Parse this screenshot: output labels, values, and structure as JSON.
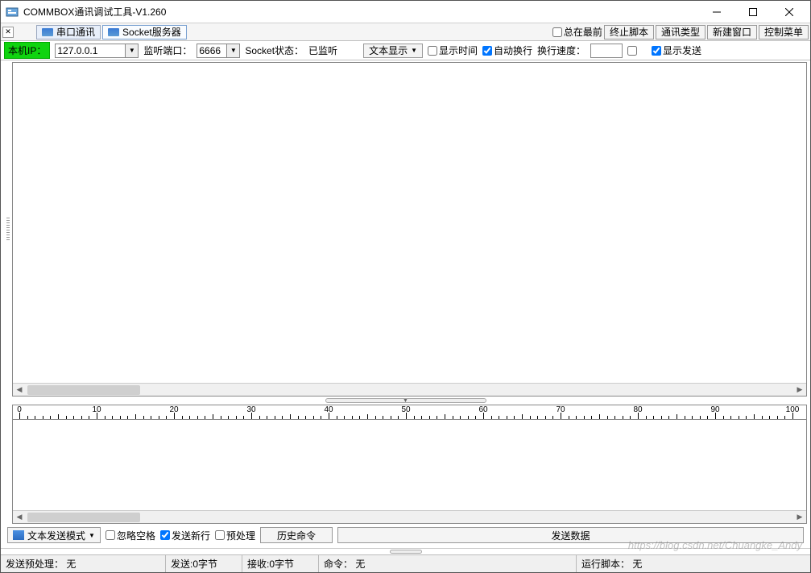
{
  "app_title": "COMMBOX通讯调试工具-V1.260",
  "tabs": {
    "serial": "串口通讯",
    "socket": "Socket服务器"
  },
  "top_right": {
    "always_on_top": "总在最前",
    "stop_script": "终止脚本",
    "comm_type": "通讯类型",
    "new_window": "新建窗口",
    "control_menu": "控制菜单"
  },
  "conn": {
    "local_ip_label": "本机IP：",
    "ip_value": "127.0.0.1",
    "listen_port_label": "监听端口：",
    "port_value": "6666",
    "socket_status_label": "Socket状态：",
    "socket_status_value": "已监听",
    "text_display": "文本显示",
    "show_time": "显示时间",
    "auto_wrap": "自动换行",
    "wrap_speed_label": "换行速度：",
    "show_send": "显示发送"
  },
  "ruler_marks": [
    "0",
    "10",
    "20",
    "30",
    "40",
    "50",
    "60",
    "70",
    "80",
    "90",
    "100"
  ],
  "bottom": {
    "send_mode": "文本发送模式",
    "ignore_space": "忽略空格",
    "send_newline": "发送新行",
    "preprocess": "预处理",
    "history": "历史命令",
    "send_data": "发送数据"
  },
  "status": {
    "pre_label": "发送预处理：",
    "pre_value": "无",
    "sent": "发送:0字节",
    "recv": "接收:0字节",
    "cmd_label": "命令：",
    "cmd_value": "无",
    "script_label": "运行脚本：",
    "script_value": "无"
  },
  "watermark": "https://blog.csdn.net/Chuangke_Andy"
}
